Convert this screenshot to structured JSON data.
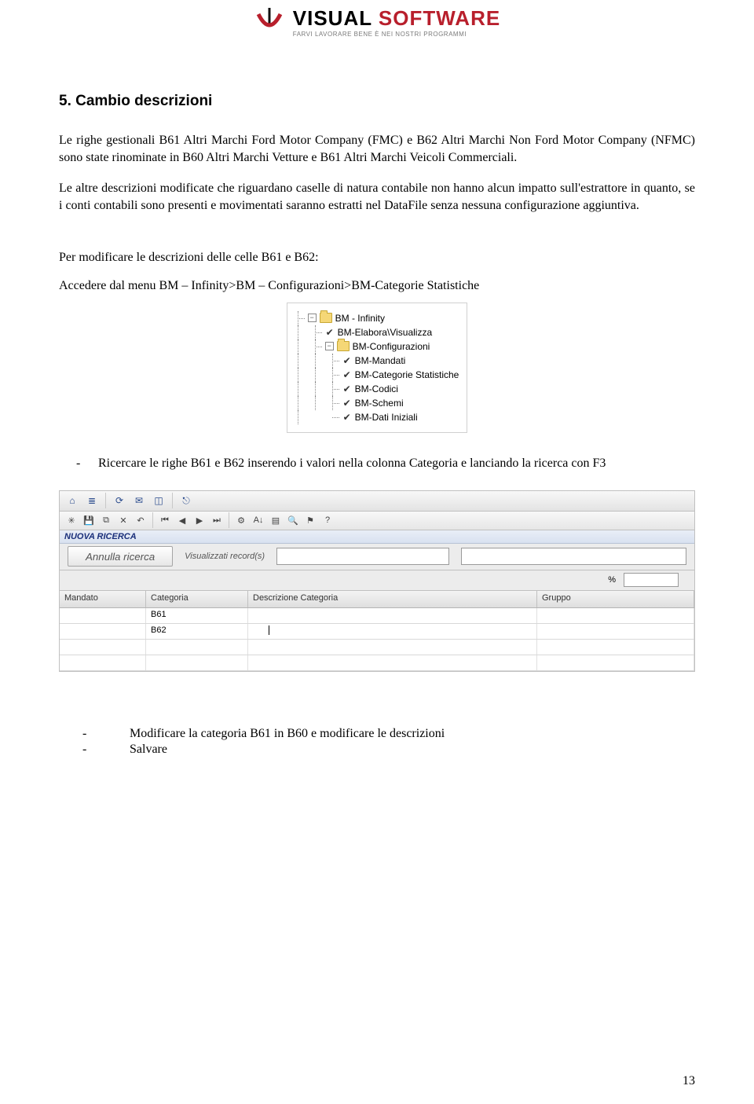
{
  "logo": {
    "name_part1": "VISUAL",
    "name_part2": "SOFTWARE",
    "tagline": "FARVI LAVORARE BENE È NEI NOSTRI PROGRAMMI"
  },
  "section_title": "5. Cambio descrizioni",
  "para1": "Le righe gestionali B61 Altri Marchi Ford Motor Company (FMC) e B62 Altri Marchi Non Ford Motor Company (NFMC) sono state rinominate in B60 Altri Marchi Vetture e B61 Altri Marchi Veicoli Commerciali.",
  "para2": "Le altre descrizioni modificate che riguardano caselle di natura contabile non hanno alcun impatto sull'estrattore in quanto, se i conti contabili sono presenti e movimentati saranno estratti nel DataFile senza nessuna configurazione aggiuntiva.",
  "subline1": "Per modificare le descrizioni delle celle B61 e B62:",
  "subline2": "Accedere dal menu BM – Infinity>BM – Configurazioni>BM-Categorie Statistiche",
  "tree": {
    "root": "BM - Infinity",
    "item0": "BM-Elabora\\Visualizza",
    "config": "BM-Configurazioni",
    "leaf1": "BM-Mandati",
    "leaf2": "BM-Categorie Statistiche",
    "leaf3": "BM-Codici",
    "leaf4": "BM-Schemi",
    "leaf5": "BM-Dati Iniziali"
  },
  "list1": "Ricercare le righe B61 e B62 inserendo i valori nella colonna Categoria e lanciando la ricerca con F3",
  "ui": {
    "banner": "NUOVA RICERCA",
    "cancel_btn": "Annulla ricerca",
    "vis_label": "Visualizzati record(s)",
    "pct": "%",
    "col_mandato": "Mandato",
    "col_categoria": "Categoria",
    "col_descr": "Descrizione Categoria",
    "col_gruppo": "Gruppo",
    "r1_cat": "B61",
    "r2_cat": "B62"
  },
  "bottom1": "Modificare la categoria B61 in B60 e modificare le descrizioni",
  "bottom2": "Salvare",
  "page_number": "13"
}
